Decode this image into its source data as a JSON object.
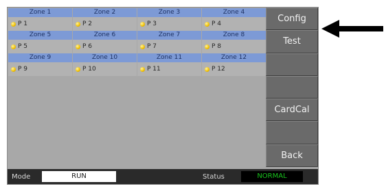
{
  "zones": [
    {
      "name": "Zone 1",
      "point": "P 1"
    },
    {
      "name": "Zone 2",
      "point": "P 2"
    },
    {
      "name": "Zone 3",
      "point": "P 3"
    },
    {
      "name": "Zone 4",
      "point": "P 4"
    },
    {
      "name": "Zone 5",
      "point": "P 5"
    },
    {
      "name": "Zone 6",
      "point": "P 6"
    },
    {
      "name": "Zone 7",
      "point": "P 7"
    },
    {
      "name": "Zone 8",
      "point": "P 8"
    },
    {
      "name": "Zone 9",
      "point": "P 9"
    },
    {
      "name": "Zone 10",
      "point": "P 10"
    },
    {
      "name": "Zone 11",
      "point": "P 11"
    },
    {
      "name": "Zone 12",
      "point": "P 12"
    }
  ],
  "side_buttons": [
    "Config",
    "Test",
    "",
    "",
    "CardCal",
    "",
    "Back"
  ],
  "status_bar": {
    "mode_label": "Mode",
    "mode_value": "RUN",
    "status_label": "Status",
    "status_value": "NORMAL"
  },
  "colors": {
    "zone_header": "#7d9ad6",
    "status_ok": "#19c21d",
    "led": "#f0c000"
  },
  "icons": {
    "indicator": "led-indicator-icon",
    "pointer": "arrow-left-icon"
  }
}
